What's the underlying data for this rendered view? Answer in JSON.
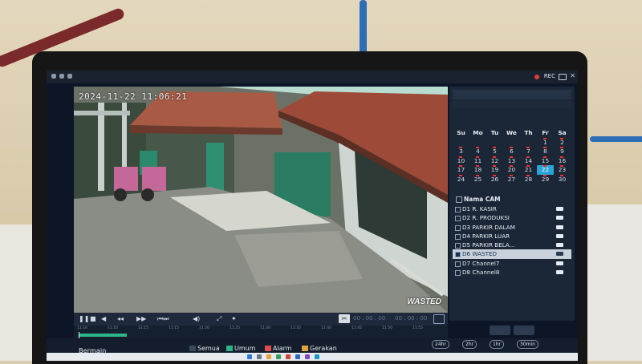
{
  "topbar": {
    "rec_label": "REC"
  },
  "video": {
    "timestamp": "2024-11-22 11:06:21",
    "camera_osd": "WASTED"
  },
  "calendar": {
    "weekdays": [
      "Su",
      "Mo",
      "Tu",
      "We",
      "Th",
      "Fr",
      "Sa"
    ],
    "weeks": [
      [
        "",
        "",
        "",
        "",
        "",
        "1",
        "2"
      ],
      [
        "3",
        "4",
        "5",
        "6",
        "7",
        "8",
        "9"
      ],
      [
        "10",
        "11",
        "12",
        "13",
        "14",
        "15",
        "16"
      ],
      [
        "17",
        "18",
        "19",
        "20",
        "21",
        "22",
        "23"
      ],
      [
        "24",
        "25",
        "26",
        "27",
        "28",
        "29",
        "30"
      ]
    ],
    "selected_day": "22"
  },
  "camera_panel": {
    "header": "Nama CAM",
    "items": [
      {
        "label": "D1 R. KASIR",
        "checked": false
      },
      {
        "label": "D2 R. PRODUKSI",
        "checked": false
      },
      {
        "label": "D3 PARKIR DALAM",
        "checked": false
      },
      {
        "label": "D4 PARKIR LUAR",
        "checked": false
      },
      {
        "label": "D5 PARKIR BELA...",
        "checked": false
      },
      {
        "label": "D6 WASTED",
        "checked": true
      },
      {
        "label": "D7 Channel7",
        "checked": false
      },
      {
        "label": "D8 Channel8",
        "checked": false
      }
    ]
  },
  "playback": {
    "time_start": "00 : 00 : 00",
    "time_end": "00 : 00 : 00"
  },
  "timeline": {
    "ticks": [
      "11:10",
      "11:10",
      "11:15",
      "11:15",
      "11:20",
      "11:25",
      "11:30",
      "11:35",
      "11:40",
      "11:45",
      "11:50",
      "11:55"
    ]
  },
  "bottom": {
    "main_label": "Bermain",
    "filters": [
      {
        "label": "Semua",
        "color": "#3a4a5c"
      },
      {
        "label": "Umum",
        "color": "#2eb38a"
      },
      {
        "label": "Alarm",
        "color": "#e04b4b"
      },
      {
        "label": "Gerakan",
        "color": "#e0a43b"
      }
    ],
    "speeds": [
      "24hr",
      "2hr",
      "1hr",
      "30min"
    ]
  }
}
